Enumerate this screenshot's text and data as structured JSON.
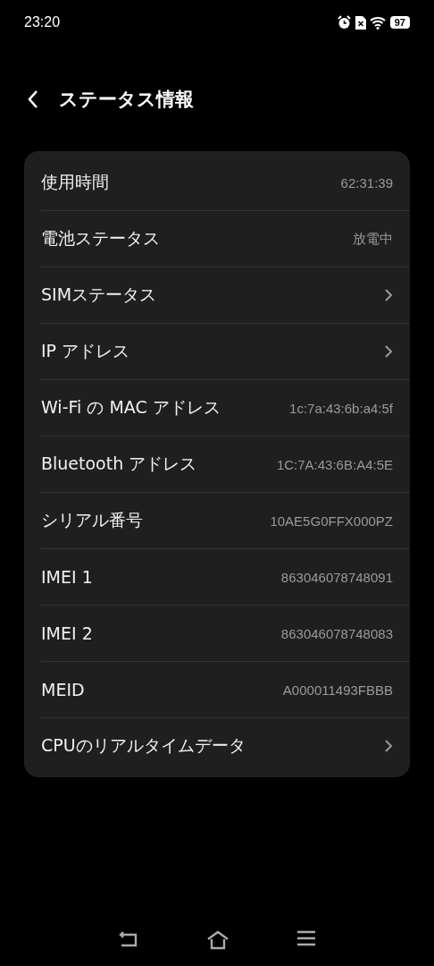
{
  "status_bar": {
    "time": "23:20",
    "battery": "97"
  },
  "header": {
    "title": "ステータス情報"
  },
  "rows": [
    {
      "label": "使用時間",
      "kind": "value",
      "value": "62:31:39"
    },
    {
      "label": "電池ステータス",
      "kind": "value",
      "value": "放電中"
    },
    {
      "label": "SIMステータス",
      "kind": "link"
    },
    {
      "label": "IP アドレス",
      "kind": "link"
    },
    {
      "label": "Wi-Fi の MAC アドレス",
      "kind": "value",
      "value": "1c:7a:43:6b:a4:5f"
    },
    {
      "label": "Bluetooth アドレス",
      "kind": "value",
      "value": "1C:7A:43:6B:A4:5E"
    },
    {
      "label": "シリアル番号",
      "kind": "value",
      "value": "10AE5G0FFX000PZ"
    },
    {
      "label": "IMEI 1",
      "kind": "value",
      "value": "863046078748091"
    },
    {
      "label": "IMEI 2",
      "kind": "value",
      "value": "863046078748083"
    },
    {
      "label": "MEID",
      "kind": "value",
      "value": "A000011493FBBB"
    },
    {
      "label": "CPUのリアルタイムデータ",
      "kind": "link"
    }
  ]
}
